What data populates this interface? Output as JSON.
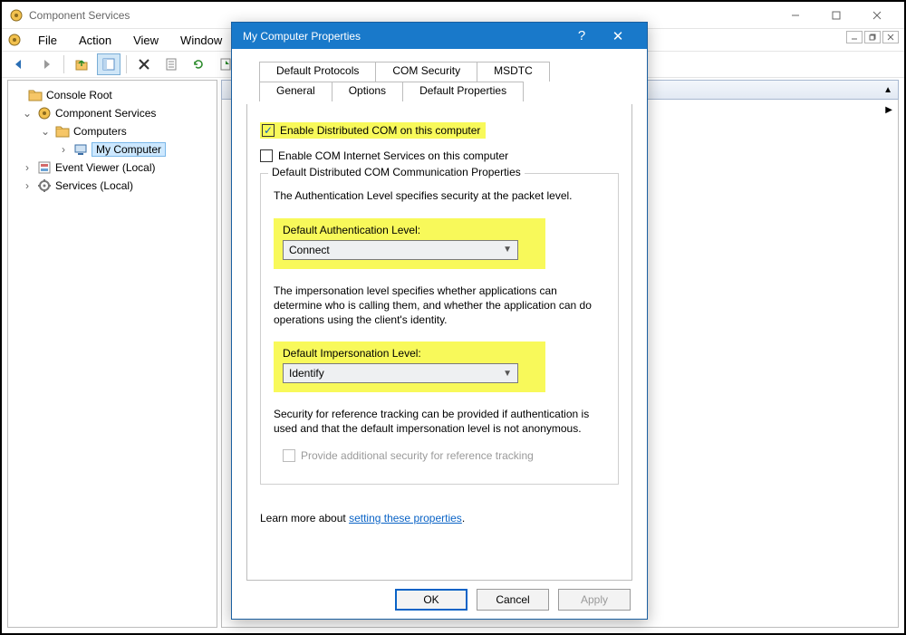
{
  "main": {
    "title": "Component Services",
    "menu": [
      "File",
      "Action",
      "View",
      "Window"
    ]
  },
  "tree": {
    "root": "Console Root",
    "svc": "Component Services",
    "computers": "Computers",
    "mycomp": "My Computer",
    "event": "Event Viewer (Local)",
    "services": "Services (Local)"
  },
  "dialog": {
    "title": "My Computer Properties",
    "tabs_row1": [
      "Default Protocols",
      "COM Security",
      "MSDTC"
    ],
    "tabs_row2": [
      "General",
      "Options",
      "Default Properties"
    ],
    "chk_dcom": "Enable Distributed COM on this computer",
    "chk_cis": "Enable COM Internet Services on this computer",
    "group_title": "Default Distributed COM Communication Properties",
    "auth_para": "The Authentication Level specifies security at the packet level.",
    "auth_label": "Default Authentication Level:",
    "auth_value": "Connect",
    "imp_para": "The impersonation level specifies whether applications can determine who is calling them, and whether the application can do operations using the client's identity.",
    "imp_label": "Default Impersonation Level:",
    "imp_value": "Identify",
    "sec_para": "Security for reference tracking can be provided if authentication is used and that the default impersonation level is not anonymous.",
    "chk_ref": "Provide additional security for reference tracking",
    "learn_prefix": "Learn more about ",
    "learn_link": "setting these properties",
    "btn_ok": "OK",
    "btn_cancel": "Cancel",
    "btn_apply": "Apply"
  }
}
